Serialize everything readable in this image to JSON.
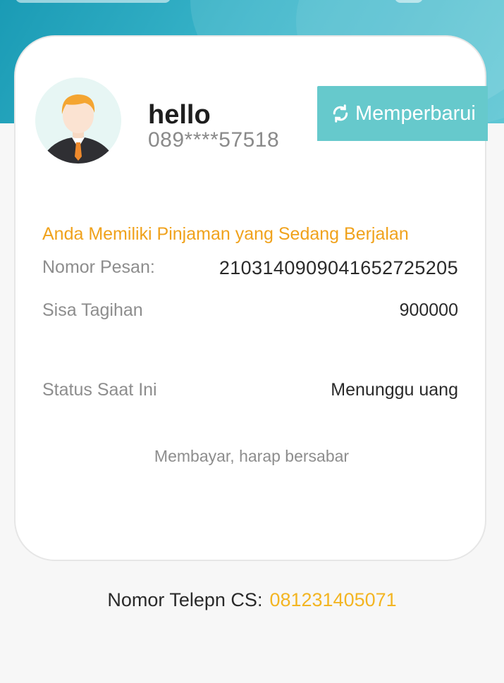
{
  "profile": {
    "name": "hello",
    "phone": "089****57518",
    "avatar_icon": "user-avatar-icon"
  },
  "refresh_button": {
    "label": "Memperbarui",
    "icon": "refresh-icon",
    "color": "#66c9cc"
  },
  "loan": {
    "notice": "Anda Memiliki Pinjaman yang Sedang Berjalan",
    "order_label": "Nomor Pesan:",
    "order_value": "21031409090416527252 05",
    "order_value_display": "210314090904165272 5205",
    "remaining_label": "Sisa Tagihan",
    "remaining_value": "900000",
    "status_label": "Status Saat Ini",
    "status_value": "Menunggu uang",
    "wait_note": "Membayar, harap bersabar"
  },
  "footer": {
    "cs_label": "Nomor Telepn CS:",
    "cs_number": "081231405071"
  },
  "colors": {
    "accent_orange": "#f0a21c",
    "cs_number_yellow": "#f3b522",
    "banner_teal": "#39b4c9"
  }
}
